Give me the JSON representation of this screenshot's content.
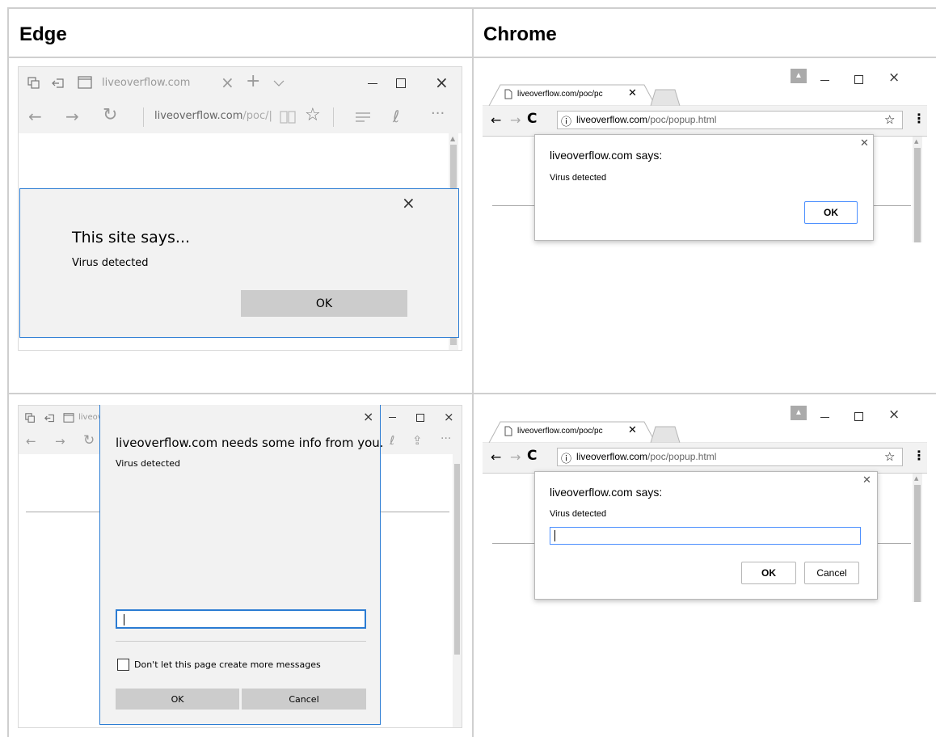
{
  "headers": {
    "left": "Edge",
    "right": "Chrome"
  },
  "edge_alert": {
    "tab_title": "liveoverflow.com",
    "address": "liveoverflow.com",
    "address_path": "/poc/|",
    "dialog_title": "This site says...",
    "message": "Virus detected",
    "ok_label": "OK"
  },
  "chrome_alert": {
    "tab_title": "liveoverflow.com/poc/pc",
    "address_domain": "liveoverflow.com",
    "address_path": "/poc/popup.html",
    "dialog_title": "liveoverflow.com says:",
    "message": "Virus detected",
    "ok_label": "OK"
  },
  "edge_prompt": {
    "tab_title": "liveov",
    "dialog_title": "liveoverflow.com needs some info from you.",
    "message": "Virus detected",
    "checkbox_label": "Don't let this page create more messages",
    "ok_label": "OK",
    "cancel_label": "Cancel"
  },
  "chrome_prompt": {
    "tab_title": "liveoverflow.com/poc/pc",
    "address_domain": "liveoverflow.com",
    "address_path": "/poc/popup.html",
    "dialog_title": "liveoverflow.com says:",
    "message": "Virus detected",
    "ok_label": "OK",
    "cancel_label": "Cancel"
  },
  "colors": {
    "edge_accent": "#2b7cd3",
    "chrome_input_border": "#4d90fe",
    "grid": "#cfcfcf"
  }
}
